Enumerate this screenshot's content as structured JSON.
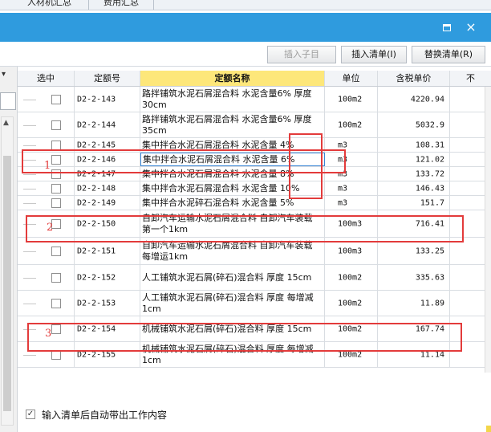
{
  "top_tabs": [
    "人材机汇总",
    "费用汇总"
  ],
  "window": {
    "restore_icon": "restore-icon",
    "close_icon": "close-icon",
    "close_glyph": "×"
  },
  "toolbar": {
    "insert_child": "插入子目",
    "insert_list": "插入清单(I)",
    "replace_list": "替换清单(R)"
  },
  "table": {
    "headers": {
      "select": "选中",
      "code": "定额号",
      "name": "定额名称",
      "unit": "单位",
      "price": "含税单价",
      "extra": "不"
    },
    "rows": [
      {
        "code": "D2-2-143",
        "name": "路拌铺筑水泥石屑混合料 水泥含量6% 厚度 30cm",
        "unit": "100m2",
        "price": "4220.94"
      },
      {
        "code": "D2-2-144",
        "name": "路拌铺筑水泥石屑混合料 水泥含量6% 厚度 35cm",
        "unit": "100m2",
        "price": "5032.9"
      },
      {
        "code": "D2-2-145",
        "name": "集中拌合水泥石屑混合料 水泥含量 4%",
        "unit": "m3",
        "price": "108.31"
      },
      {
        "code": "D2-2-146",
        "name": "集中拌合水泥石屑混合料 水泥含量 6%",
        "unit": "m3",
        "price": "121.02"
      },
      {
        "code": "D2-2-147",
        "name": "集中拌合水泥石屑混合料 水泥含量 8%",
        "unit": "m3",
        "price": "133.72"
      },
      {
        "code": "D2-2-148",
        "name": "集中拌合水泥石屑混合料 水泥含量 10%",
        "unit": "m3",
        "price": "146.43"
      },
      {
        "code": "D2-2-149",
        "name": "集中拌合水泥碎石混合料 水泥含量 5%",
        "unit": "m3",
        "price": "151.7"
      },
      {
        "code": "D2-2-150",
        "name": "自卸汽车运输水泥石屑混合料 自卸汽车装载 第一个1km",
        "unit": "100m3",
        "price": "716.41"
      },
      {
        "code": "D2-2-151",
        "name": "自卸汽车运输水泥石屑混合料 自卸汽车装载 每增运1km",
        "unit": "100m3",
        "price": "133.25"
      },
      {
        "code": "D2-2-152",
        "name": "人工铺筑水泥石屑(碎石)混合料 厚度 15cm",
        "unit": "100m2",
        "price": "335.63"
      },
      {
        "code": "D2-2-153",
        "name": "人工铺筑水泥石屑(碎石)混合料 厚度 每增减1cm",
        "unit": "100m2",
        "price": "11.89"
      },
      {
        "code": "D2-2-154",
        "name": "机械铺筑水泥石屑(碎石)混合料 厚度 15cm",
        "unit": "100m2",
        "price": "167.74"
      },
      {
        "code": "D2-2-155",
        "name": "机械铺筑水泥石屑(碎石)混合料 厚度 每增减1cm",
        "unit": "100m2",
        "price": "11.14"
      }
    ]
  },
  "annotations": [
    "1",
    "2",
    "3"
  ],
  "bottom": {
    "checkbox_label": "输入清单后自动带出工作内容",
    "check_glyph": "✓"
  },
  "colors": {
    "titlebar": "#2f9bde",
    "highlight_header": "#fde77a",
    "annotation_red": "#e33b3b"
  }
}
